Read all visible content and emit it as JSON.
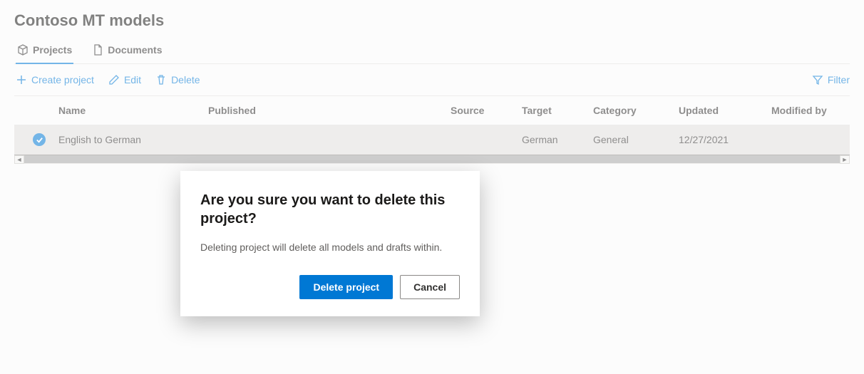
{
  "page": {
    "title": "Contoso MT models"
  },
  "tabs": {
    "projects": "Projects",
    "documents": "Documents"
  },
  "toolbar": {
    "create": "Create project",
    "edit": "Edit",
    "delete": "Delete",
    "filter": "Filter"
  },
  "columns": {
    "name": "Name",
    "published": "Published",
    "source": "Source",
    "target": "Target",
    "category": "Category",
    "updated": "Updated",
    "modified_by": "Modified by"
  },
  "rows": [
    {
      "name": "English to German",
      "published": "",
      "source": "",
      "target": "German",
      "category": "General",
      "updated": "12/27/2021",
      "modified_by": ""
    }
  ],
  "dialog": {
    "title": "Are you sure you want to delete this project?",
    "body": "Deleting project will delete all models and drafts within.",
    "primary": "Delete project",
    "secondary": "Cancel"
  }
}
